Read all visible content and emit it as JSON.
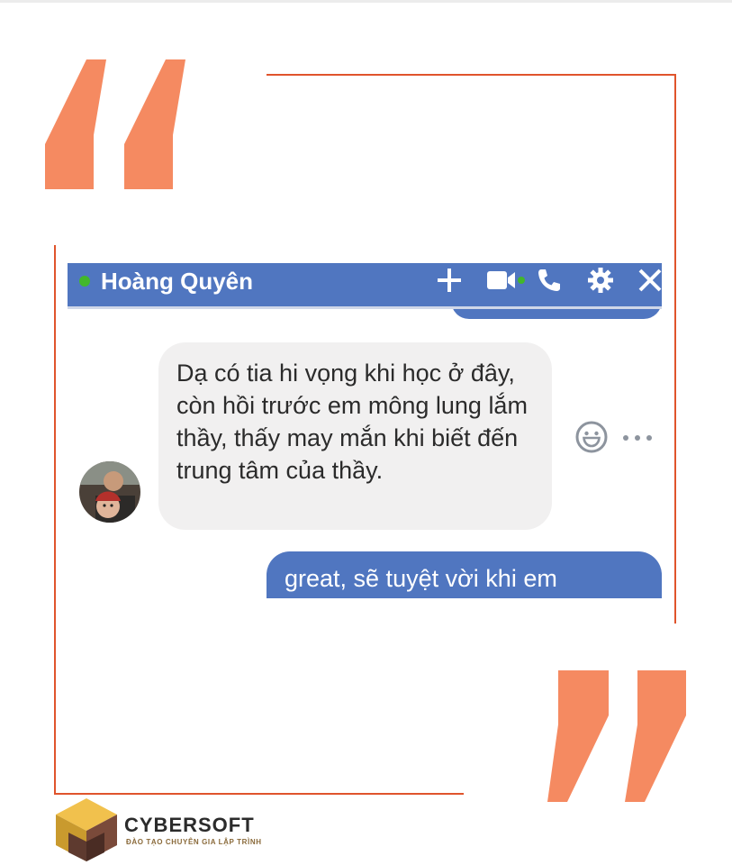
{
  "chat": {
    "contact_name": "Hoàng Quyên",
    "messages": [
      {
        "direction": "incoming",
        "text": "Dạ có tia hi vọng khi học ở đây, còn hồi trước em mông lung lắm thầy, thấy may mắn khi biết đến trung tâm của thầy."
      },
      {
        "direction": "outgoing",
        "text": "great, sẽ tuyệt vời khi em"
      }
    ],
    "header_icons": [
      "plus-icon",
      "video-call-icon",
      "phone-icon",
      "settings-gear-icon",
      "close-icon"
    ]
  },
  "brand": {
    "name": "CYBERSOFT",
    "tagline": "ĐÀO TẠO CHUYÊN GIA LẬP TRÌNH"
  },
  "colors": {
    "quote_orange": "#f58a61",
    "frame_line": "#e0542c",
    "messenger_blue": "#5076c0",
    "incoming_bubble": "#f1f0f0",
    "online_green": "#42b72a"
  }
}
